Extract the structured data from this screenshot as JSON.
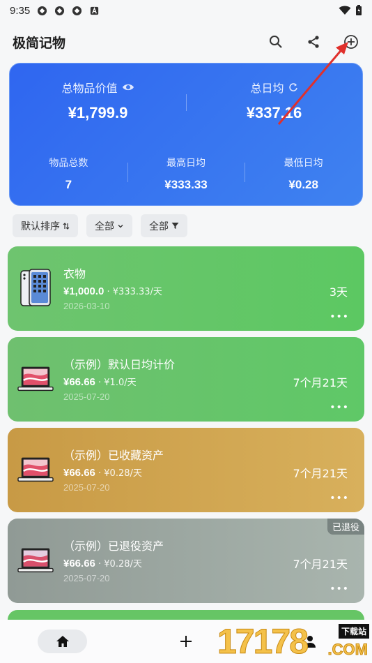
{
  "status_bar": {
    "time": "9:35"
  },
  "app_bar": {
    "title": "极简记物"
  },
  "summary": {
    "total_value_label": "总物品价值",
    "total_value": "¥1,799.9",
    "daily_avg_label": "总日均",
    "daily_avg": "¥337.16",
    "item_count_label": "物品总数",
    "item_count": "7",
    "max_daily_label": "最高日均",
    "max_daily": "¥333.33",
    "min_daily_label": "最低日均",
    "min_daily": "¥0.28"
  },
  "filters": {
    "sort": "默认排序",
    "category": "全部",
    "filter": "全部"
  },
  "items": [
    {
      "name": "衣物",
      "price": "¥1,000.0",
      "daily": " · ¥333.33/天",
      "date": "2026-03-10",
      "duration": "3天",
      "more": "•••"
    },
    {
      "name": "（示例）默认日均计价",
      "price": "¥66.66",
      "daily": " · ¥1.0/天",
      "date": "2025-07-20",
      "duration": "7个月21天",
      "more": "•••"
    },
    {
      "name": "（示例）已收藏资产",
      "price": "¥66.66",
      "daily": " · ¥0.28/天",
      "date": "2025-07-20",
      "duration": "7个月21天",
      "more": "•••"
    },
    {
      "name": "（示例）已退役资产",
      "price": "¥66.66",
      "daily": " · ¥0.28/天",
      "date": "2025-07-20",
      "duration": "7个月21天",
      "more": "•••",
      "badge": "已退役"
    }
  ],
  "watermark": {
    "number": "17178",
    "tag": "下载站",
    "suffix": ".COM"
  },
  "colors": {
    "summary_bg": "#2f66f0",
    "item_green": "#62c565",
    "item_gold": "#d0a650",
    "item_grey": "#9ea8a2",
    "arrow": "#e0302c"
  }
}
